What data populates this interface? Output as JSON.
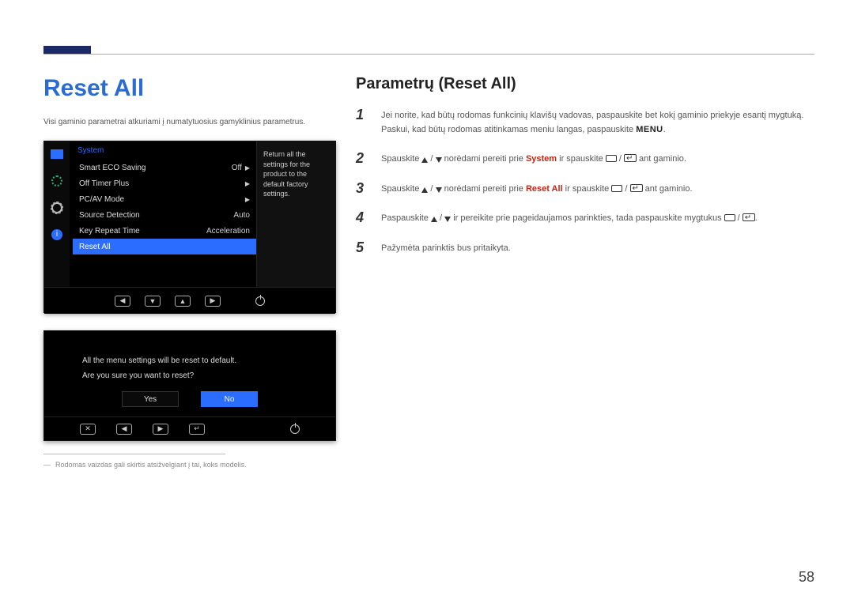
{
  "page_number": "58",
  "left": {
    "heading": "Reset All",
    "intro": "Visi gaminio parametrai atkuriami į numatytuosius gamyklinius parametrus.",
    "osd": {
      "title": "System",
      "rows": [
        {
          "label": "Smart ECO Saving",
          "value": "Off",
          "arrow": true
        },
        {
          "label": "Off Timer Plus",
          "value": "",
          "arrow": true
        },
        {
          "label": "PC/AV Mode",
          "value": "",
          "arrow": true
        },
        {
          "label": "Source Detection",
          "value": "Auto",
          "arrow": false
        },
        {
          "label": "Key Repeat Time",
          "value": "Acceleration",
          "arrow": false
        }
      ],
      "selected_label": "Reset All",
      "side_text": "Return all the settings for the product to the default factory settings."
    },
    "dialog": {
      "line1": "All the menu settings will be reset to default.",
      "line2": "Are you sure you want to reset?",
      "yes": "Yes",
      "no": "No"
    },
    "footnote": "Rodomas vaizdas gali skirtis atsižvelgiant į tai, koks modelis."
  },
  "right": {
    "heading": "Parametrų (Reset All)",
    "steps": {
      "s1a": "Jei norite, kad būtų rodomas funkcinių klavišų vadovas, paspauskite bet kokį gaminio priekyje esantį mygtuką. Paskui, kad būtų rodomas atitinkamas meniu langas, paspauskite ",
      "s1_menu": "MENU",
      "s1b": ".",
      "s2a": "Spauskite ",
      "s2b": " norėdami pereiti prie ",
      "s2_system": "System",
      "s2c": " ir spauskite ",
      "s2d": " ant gaminio.",
      "s3a": "Spauskite ",
      "s3b": " norėdami pereiti prie ",
      "s3_reset": "Reset All",
      "s3c": " ir spauskite ",
      "s3d": " ant gaminio.",
      "s4a": "Paspauskite ",
      "s4b": " ir pereikite prie pageidaujamos parinkties, tada paspauskite mygtukus ",
      "s4c": ".",
      "s5": "Pažymėta parinktis bus pritaikyta."
    }
  }
}
